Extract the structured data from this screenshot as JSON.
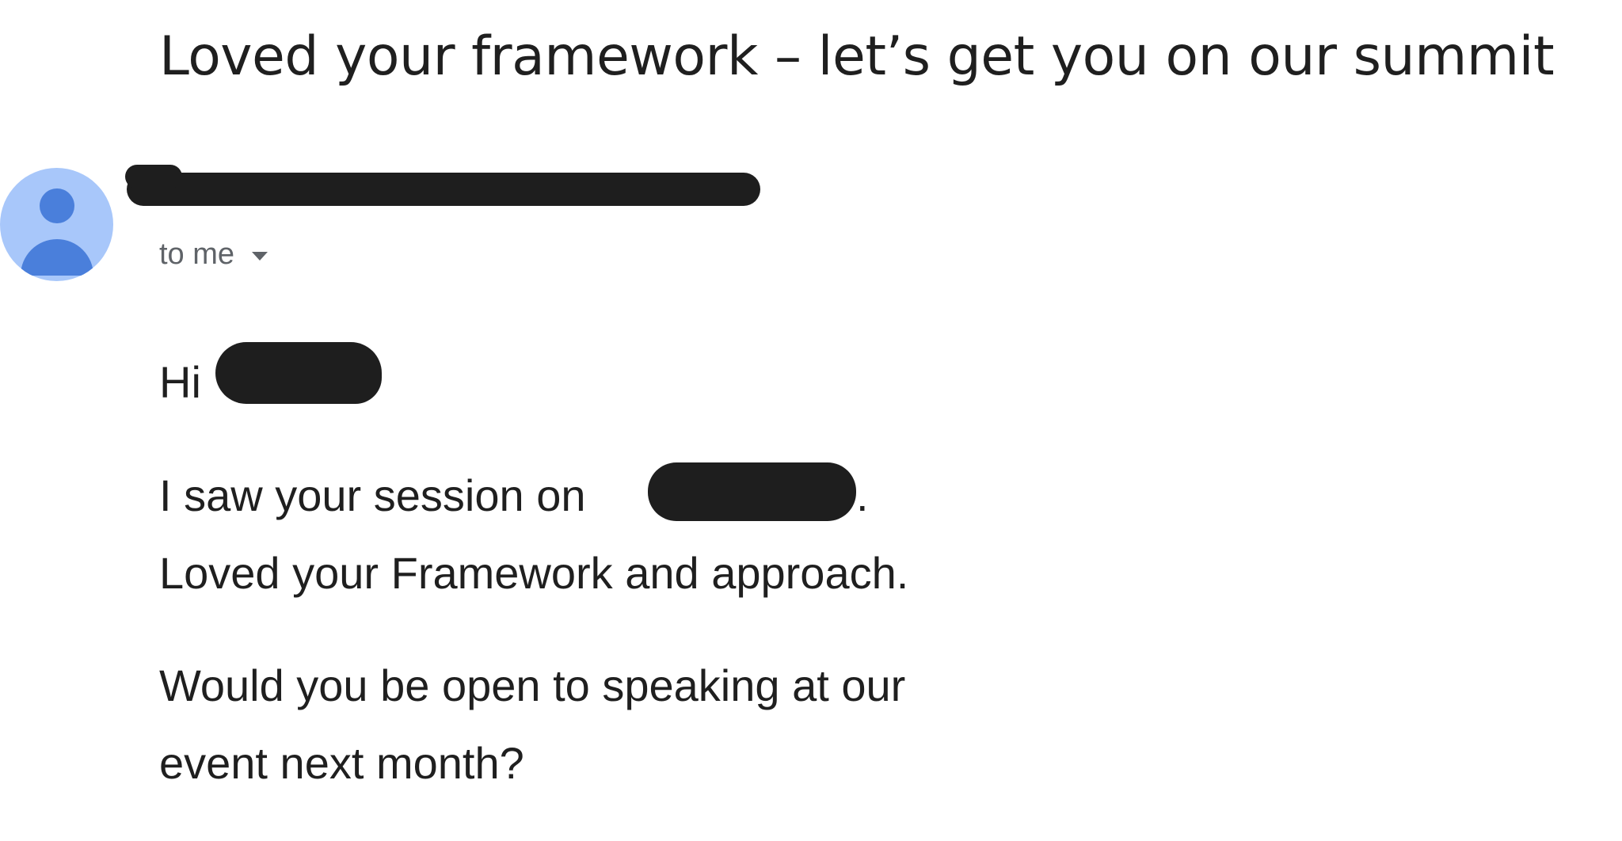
{
  "email": {
    "subject": "Loved your framework – let’s get you on our summit",
    "recipient_label": "to me",
    "greeting": "Hi",
    "body_line1": "I saw your session on",
    "body_line1_end": ".",
    "body_line2": "Loved your Framework and approach.",
    "body_line3": "Would you be open to speaking at our",
    "body_line4": "event next month?"
  },
  "icons": {
    "avatar": "default-person-avatar-icon",
    "recipient_caret": "caret-down-icon"
  },
  "colors": {
    "avatar_bg": "#a8c7fa",
    "avatar_fg": "#4a7fdb",
    "redaction": "#1e1e1e",
    "secondary_text": "#5f6368"
  }
}
